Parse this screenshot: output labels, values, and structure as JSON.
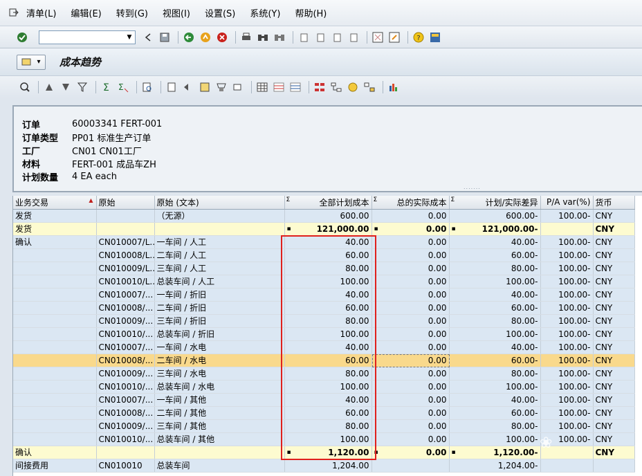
{
  "menu": {
    "items": [
      "清单(L)",
      "编辑(E)",
      "转到(G)",
      "视图(I)",
      "设置(S)",
      "系统(Y)",
      "帮助(H)"
    ]
  },
  "command_field": {
    "value": ""
  },
  "title": "成本趋势",
  "header": {
    "rows": [
      {
        "label": "订单",
        "value": "60003341 FERT-001"
      },
      {
        "label": "订单类型",
        "value": "PP01 标准生产订单"
      },
      {
        "label": "工厂",
        "value": "CN01 CN01工厂"
      },
      {
        "label": "材料",
        "value": "FERT-001 成品车ZH"
      },
      {
        "label": "计划数量",
        "value": "4 EA each"
      }
    ]
  },
  "grid": {
    "columns": [
      "业务交易",
      "原始",
      "原始 (文本)",
      "全部计划成本",
      "总的实际成本",
      "计划/实际差异",
      "P/A var(%)",
      "货币"
    ],
    "sum_marker": "Σ",
    "rows": [
      {
        "type": "blue",
        "cells": [
          "发货",
          "",
          "（无源）",
          "600.00",
          "0.00",
          "600.00-",
          "100.00-",
          "CNY"
        ]
      },
      {
        "type": "sub",
        "cells": [
          "发货",
          "",
          "",
          "121,000.00",
          "0.00",
          "121,000.00-",
          "",
          "CNY"
        ]
      },
      {
        "type": "blue",
        "cells": [
          "确认",
          "CN010007/L...",
          "一车间 / 人工",
          "40.00",
          "0.00",
          "40.00-",
          "100.00-",
          "CNY"
        ]
      },
      {
        "type": "blue",
        "cells": [
          "",
          "CN010008/L...",
          "二车间 / 人工",
          "60.00",
          "0.00",
          "60.00-",
          "100.00-",
          "CNY"
        ]
      },
      {
        "type": "blue",
        "cells": [
          "",
          "CN010009/L...",
          "三车间 / 人工",
          "80.00",
          "0.00",
          "80.00-",
          "100.00-",
          "CNY"
        ]
      },
      {
        "type": "blue",
        "cells": [
          "",
          "CN010010/L...",
          "总装车间 / 人工",
          "100.00",
          "0.00",
          "100.00-",
          "100.00-",
          "CNY"
        ]
      },
      {
        "type": "blue",
        "cells": [
          "",
          "CN010007/...",
          "一车间 / 折旧",
          "40.00",
          "0.00",
          "40.00-",
          "100.00-",
          "CNY"
        ]
      },
      {
        "type": "blue",
        "cells": [
          "",
          "CN010008/...",
          "二车间 / 折旧",
          "60.00",
          "0.00",
          "60.00-",
          "100.00-",
          "CNY"
        ]
      },
      {
        "type": "blue",
        "cells": [
          "",
          "CN010009/...",
          "三车间 / 折旧",
          "80.00",
          "0.00",
          "80.00-",
          "100.00-",
          "CNY"
        ]
      },
      {
        "type": "blue",
        "cells": [
          "",
          "CN010010/...",
          "总装车间 / 折旧",
          "100.00",
          "0.00",
          "100.00-",
          "100.00-",
          "CNY"
        ]
      },
      {
        "type": "blue",
        "cells": [
          "",
          "CN010007/...",
          "一车间 / 水电",
          "40.00",
          "0.00",
          "40.00-",
          "100.00-",
          "CNY"
        ]
      },
      {
        "type": "sel",
        "cells": [
          "",
          "CN010008/...",
          "二车间 / 水电",
          "60.00",
          "0.00",
          "60.00-",
          "100.00-",
          "CNY"
        ]
      },
      {
        "type": "blue",
        "cells": [
          "",
          "CN010009/...",
          "三车间 / 水电",
          "80.00",
          "0.00",
          "80.00-",
          "100.00-",
          "CNY"
        ]
      },
      {
        "type": "blue",
        "cells": [
          "",
          "CN010010/...",
          "总装车间 / 水电",
          "100.00",
          "0.00",
          "100.00-",
          "100.00-",
          "CNY"
        ]
      },
      {
        "type": "blue",
        "cells": [
          "",
          "CN010007/...",
          "一车间 / 其他",
          "40.00",
          "0.00",
          "40.00-",
          "100.00-",
          "CNY"
        ]
      },
      {
        "type": "blue",
        "cells": [
          "",
          "CN010008/...",
          "二车间 / 其他",
          "60.00",
          "0.00",
          "60.00-",
          "100.00-",
          "CNY"
        ]
      },
      {
        "type": "blue",
        "cells": [
          "",
          "CN010009/...",
          "三车间 / 其他",
          "80.00",
          "0.00",
          "80.00-",
          "100.00-",
          "CNY"
        ]
      },
      {
        "type": "blue",
        "cells": [
          "",
          "CN010010/...",
          "总装车间 / 其他",
          "100.00",
          "0.00",
          "100.00-",
          "100.00-",
          "CNY"
        ]
      },
      {
        "type": "sub",
        "cells": [
          "确认",
          "",
          "",
          "1,120.00",
          "0.00",
          "1,120.00-",
          "",
          "CNY"
        ]
      },
      {
        "type": "blue",
        "cells": [
          "间接费用",
          "CN010010",
          "总装车间",
          "1,204.00",
          "",
          "1,204.00-",
          "",
          ""
        ]
      }
    ]
  },
  "colors": {
    "highlight_box": "#e0201c",
    "selected_row": "#f9d98c",
    "subtotal_row": "#fdfbd0",
    "data_row": "#dbe7f3"
  }
}
